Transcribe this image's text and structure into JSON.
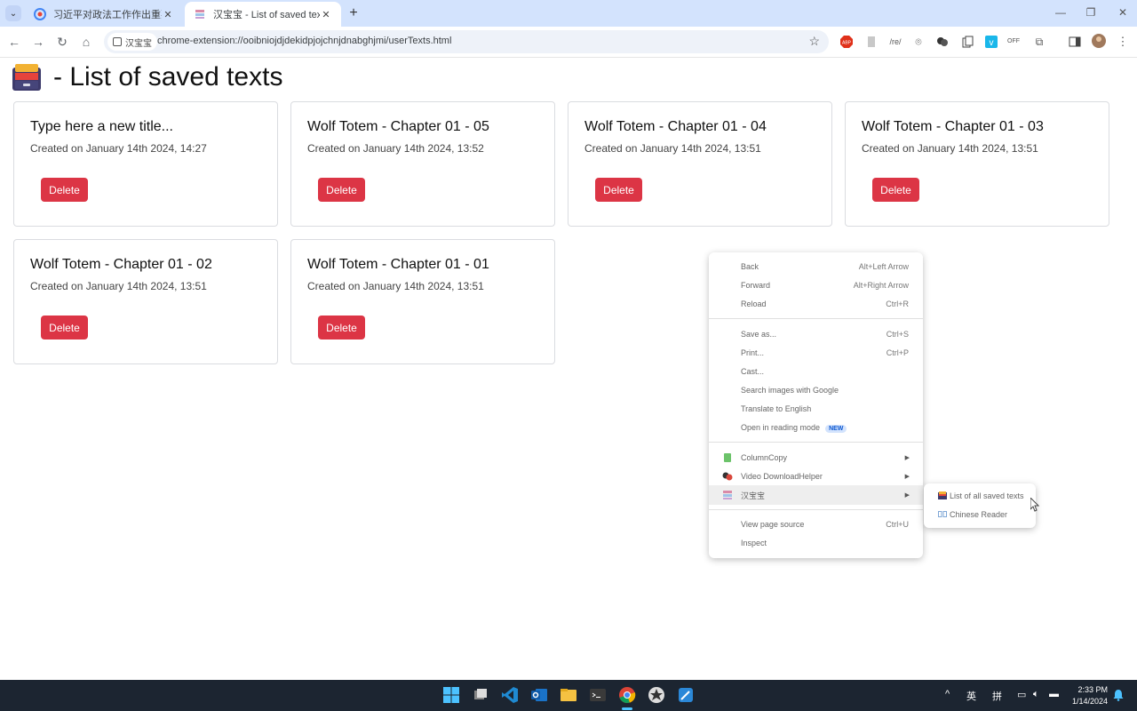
{
  "browser": {
    "tabs": [
      {
        "title": "习近平对政法工作作出重要指示",
        "active": false
      },
      {
        "title": "汉宝宝 - List of saved texts",
        "active": true
      }
    ],
    "omnibox": {
      "chip_label": "汉宝宝",
      "url": "chrome-extension://ooibniojdjdekidpjojchnjdnabghjmi/userTexts.html"
    },
    "extensions": [
      "abp-icon",
      "page-icon",
      "regex-icon",
      "camera-icon",
      "video-dl-icon",
      "copy-icon",
      "vimeo-icon",
      "off-icon",
      "puzzle-icon"
    ],
    "ext_labels": {
      "abp": "ABP",
      "regex": "/re/",
      "off": "OFF"
    }
  },
  "page": {
    "heading": "- List of saved texts",
    "delete_label": "Delete",
    "cards": [
      {
        "title": "Type here a new title...",
        "created": "Created on January 14th 2024, 14:27"
      },
      {
        "title": "Wolf Totem - Chapter 01 - 05",
        "created": "Created on January 14th 2024, 13:52"
      },
      {
        "title": "Wolf Totem - Chapter 01 - 04",
        "created": "Created on January 14th 2024, 13:51"
      },
      {
        "title": "Wolf Totem - Chapter 01 - 03",
        "created": "Created on January 14th 2024, 13:51"
      },
      {
        "title": "Wolf Totem - Chapter 01 - 02",
        "created": "Created on January 14th 2024, 13:51"
      },
      {
        "title": "Wolf Totem - Chapter 01 - 01",
        "created": "Created on January 14th 2024, 13:51"
      }
    ]
  },
  "context_menu": {
    "items": [
      {
        "label": "Back",
        "shortcut": "Alt+Left Arrow"
      },
      {
        "label": "Forward",
        "shortcut": "Alt+Right Arrow"
      },
      {
        "label": "Reload",
        "shortcut": "Ctrl+R"
      },
      {
        "label": "Save as...",
        "shortcut": "Ctrl+S"
      },
      {
        "label": "Print...",
        "shortcut": "Ctrl+P"
      },
      {
        "label": "Cast..."
      },
      {
        "label": "Search images with Google"
      },
      {
        "label": "Translate to English"
      },
      {
        "label": "Open in reading mode",
        "badge": "NEW"
      },
      {
        "label": "ColumnCopy"
      },
      {
        "label": "Video DownloadHelper"
      },
      {
        "label": "汉宝宝"
      },
      {
        "label": "View page source",
        "shortcut": "Ctrl+U"
      },
      {
        "label": "Inspect"
      }
    ],
    "submenu": [
      {
        "label": "List of all saved texts"
      },
      {
        "label": "Chinese Reader"
      }
    ]
  },
  "taskbar": {
    "tray": {
      "lang1": "英",
      "lang2": "拼"
    },
    "clock": {
      "time": "2:33 PM",
      "date": "1/14/2024"
    }
  },
  "colors": {
    "delete_button": "#dc3545",
    "tabstrip": "#d3e3fd",
    "taskbar": "#1c2531"
  }
}
